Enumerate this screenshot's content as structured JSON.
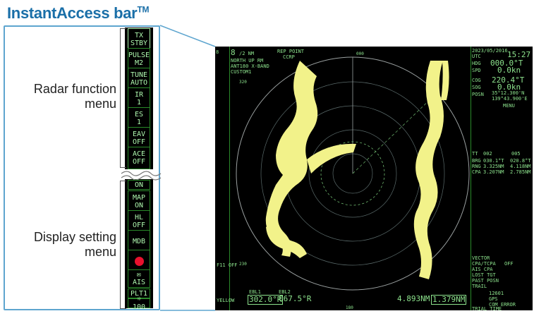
{
  "header": {
    "title": "InstantAccess bar",
    "tm": "TM"
  },
  "sections": {
    "radar_menu": {
      "line1": "Radar function",
      "line2": "menu"
    },
    "display_menu": {
      "line1": "Display setting",
      "line2": "menu"
    }
  },
  "bar": {
    "tx_stby": {
      "l1": "TX",
      "l2": "STBY"
    },
    "pulse": {
      "l1": "PULSE",
      "l2": "M2"
    },
    "tune": {
      "l1": "TUNE",
      "l2": "AUTO"
    },
    "ir": {
      "l1": "IR",
      "l2": "1"
    },
    "es": {
      "l1": "ES",
      "l2": "1"
    },
    "eav": {
      "l1": "EAV",
      "l2": "OFF"
    },
    "ace": {
      "l1": "ACE",
      "l2": "OFF"
    },
    "on": "ON",
    "map": {
      "l1": "MAP",
      "l2": "ON"
    },
    "hl": {
      "l1": "HL",
      "l2": "OFF"
    },
    "mdb": "MDB",
    "ais": "AIS",
    "plt": "PLT1",
    "brill": "100"
  },
  "screen": {
    "range": "8",
    "range_sub": "/2 NM",
    "mode": "NORTH UP RM",
    "ant": "ANT180 X-BAND",
    "custom": "CUSTOM1",
    "rep_point": "REP POINT",
    "ccrp": "CCRP",
    "time": "15:27",
    "utc": "UTC",
    "date": "2023/05/2016",
    "hdg_label": "HDG",
    "hdg": "000.0°T",
    "spd_label": "SPD",
    "spd": "0.0kn",
    "cog_label": "COG",
    "cog": "220.4°T",
    "sog_label": "SOG",
    "sog": "0.0kn",
    "posn_label": "POSN",
    "lat": "35°12.300'N",
    "lon": "139°43.900'E",
    "menu": "MENU",
    "tt_header": "TT",
    "tt1": "002",
    "tt2": "005",
    "brg_label": "BRG",
    "brg1": "030.1°T",
    "brg2": "020.8°T",
    "rng_label": "RNG",
    "rng1": "3.325NM",
    "rng2": "4.118NM",
    "cpa_label": "CPA",
    "cpa1": "3.207NM",
    "cpa2": "2.785NM",
    "vector": "VECTOR",
    "cpa_tcpa": "CPA/TCPA",
    "ais_cpa": "AIS CPA",
    "lost_tgt": "LOST TGT",
    "past_posn": "PAST POSN",
    "off": "OFF",
    "ebl1": "EBL1",
    "ebl1_val": "302.0°R",
    "ebl2": "EBL2",
    "ebl2_val": "067.5°R",
    "vrm1_val": "4.893NM",
    "vrm2_val": "1.379NM",
    "f11": "F11 OFF",
    "trail": "TRAIL",
    "yellow": "YELLOW",
    "brill_num": "12601",
    "gps": "GPS",
    "com_error": "COM ERROR",
    "trial_time": "TRIAL TIME"
  },
  "colors": {
    "accent": "#1a6fa8",
    "frame": "#5ea5cf",
    "echo": "#f2f28a",
    "display_green": "#8de38d"
  }
}
